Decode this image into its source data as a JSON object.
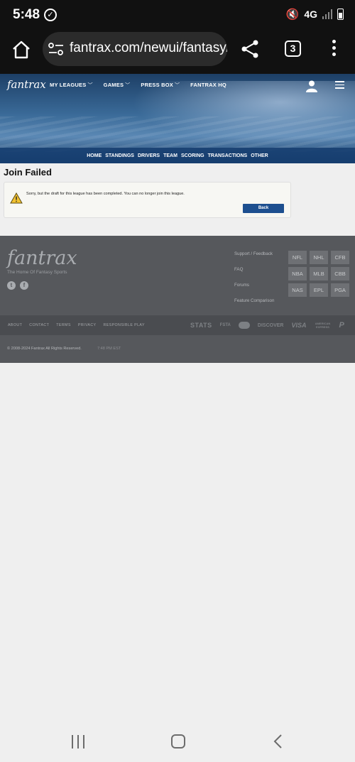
{
  "status_bar": {
    "time": "5:48",
    "network": "4G"
  },
  "browser": {
    "url": "fantrax.com/newui/fantasy/joi",
    "tab_count": "3"
  },
  "header": {
    "logo": "fantrax",
    "nav": [
      {
        "label": "MY LEAGUES",
        "dropdown": true
      },
      {
        "label": "GAMES",
        "dropdown": true
      },
      {
        "label": "PRESS BOX",
        "dropdown": true
      },
      {
        "label": "FANTRAX HQ",
        "dropdown": false
      }
    ],
    "subnav": [
      "HOME",
      "STANDINGS",
      "DRIVERS",
      "TEAM",
      "SCORING",
      "TRANSACTIONS",
      "OTHER"
    ]
  },
  "main": {
    "title": "Join Failed",
    "message": "Sorry, but the draft for this league has been completed. You can no longer join this league.",
    "back_label": "Back"
  },
  "footer": {
    "logo": "fantrax",
    "tagline": "The Home Of Fantasy Sports",
    "links": [
      "Support / Feedback",
      "FAQ",
      "Forums",
      "Feature Comparison"
    ],
    "sports": [
      "NFL",
      "NHL",
      "CFB",
      "NBA",
      "MLB",
      "CBB",
      "NAS",
      "EPL",
      "PGA"
    ],
    "legal": [
      "ABOUT",
      "CONTACT",
      "TERMS",
      "PRIVACY",
      "RESPONSIBLE PLAY"
    ],
    "partners": {
      "stats": "STATS",
      "fsta": "FSTA",
      "discover": "DISCOVER",
      "visa": "VISA",
      "amex": "AMERICAN EXPRESS"
    },
    "copyright": "© 2008-2024 Fantrax All Rights Reserved.",
    "clock": "7:48 PM EST"
  },
  "colors": {
    "accent": "#1d4f8f",
    "footer": "#56585c",
    "header": "#2a5582"
  }
}
